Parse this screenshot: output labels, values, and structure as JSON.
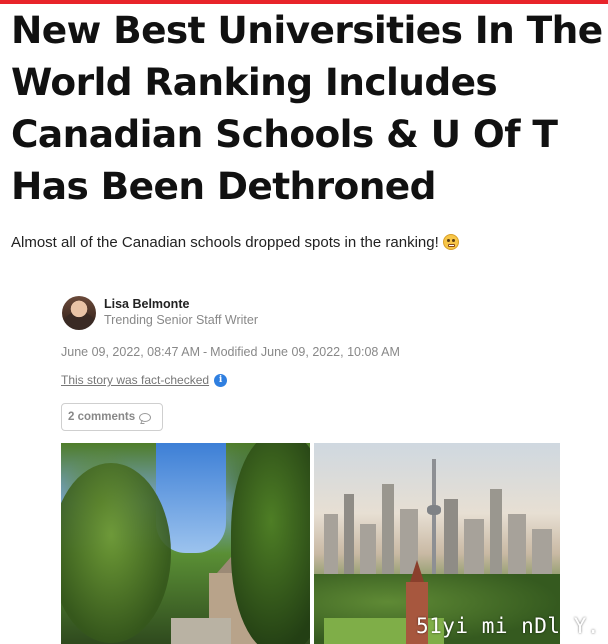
{
  "brand": {
    "accent_color": "#e8242a",
    "info_color": "#2f7fe0"
  },
  "article": {
    "headline_lines": [
      "New Best Universities In The",
      "World Ranking Includes",
      "Canadian Schools & U Of T",
      "Has Been Dethroned"
    ],
    "dek": "Almost all of the Canadian schools dropped spots in the ranking!",
    "dek_emoji_icon": "grimacing-face-icon"
  },
  "author": {
    "name": "Lisa Belmonte",
    "role": "Trending Senior Staff Writer",
    "avatar_icon": "author-avatar"
  },
  "dates": {
    "published": "June 09, 2022, 08:47 AM",
    "separator": "-",
    "modified": "Modified June 09, 2022, 10:08 AM"
  },
  "fact_check": {
    "link_text": "This story was fact-checked",
    "icon": "info-icon",
    "icon_glyph": "i"
  },
  "comments": {
    "label": "2 comments",
    "icon": "comment-bubble-icon"
  },
  "images": {
    "left": "campus-trees-photo",
    "right": "toronto-skyline-photo"
  },
  "watermark": "51yi mi nDl Y."
}
